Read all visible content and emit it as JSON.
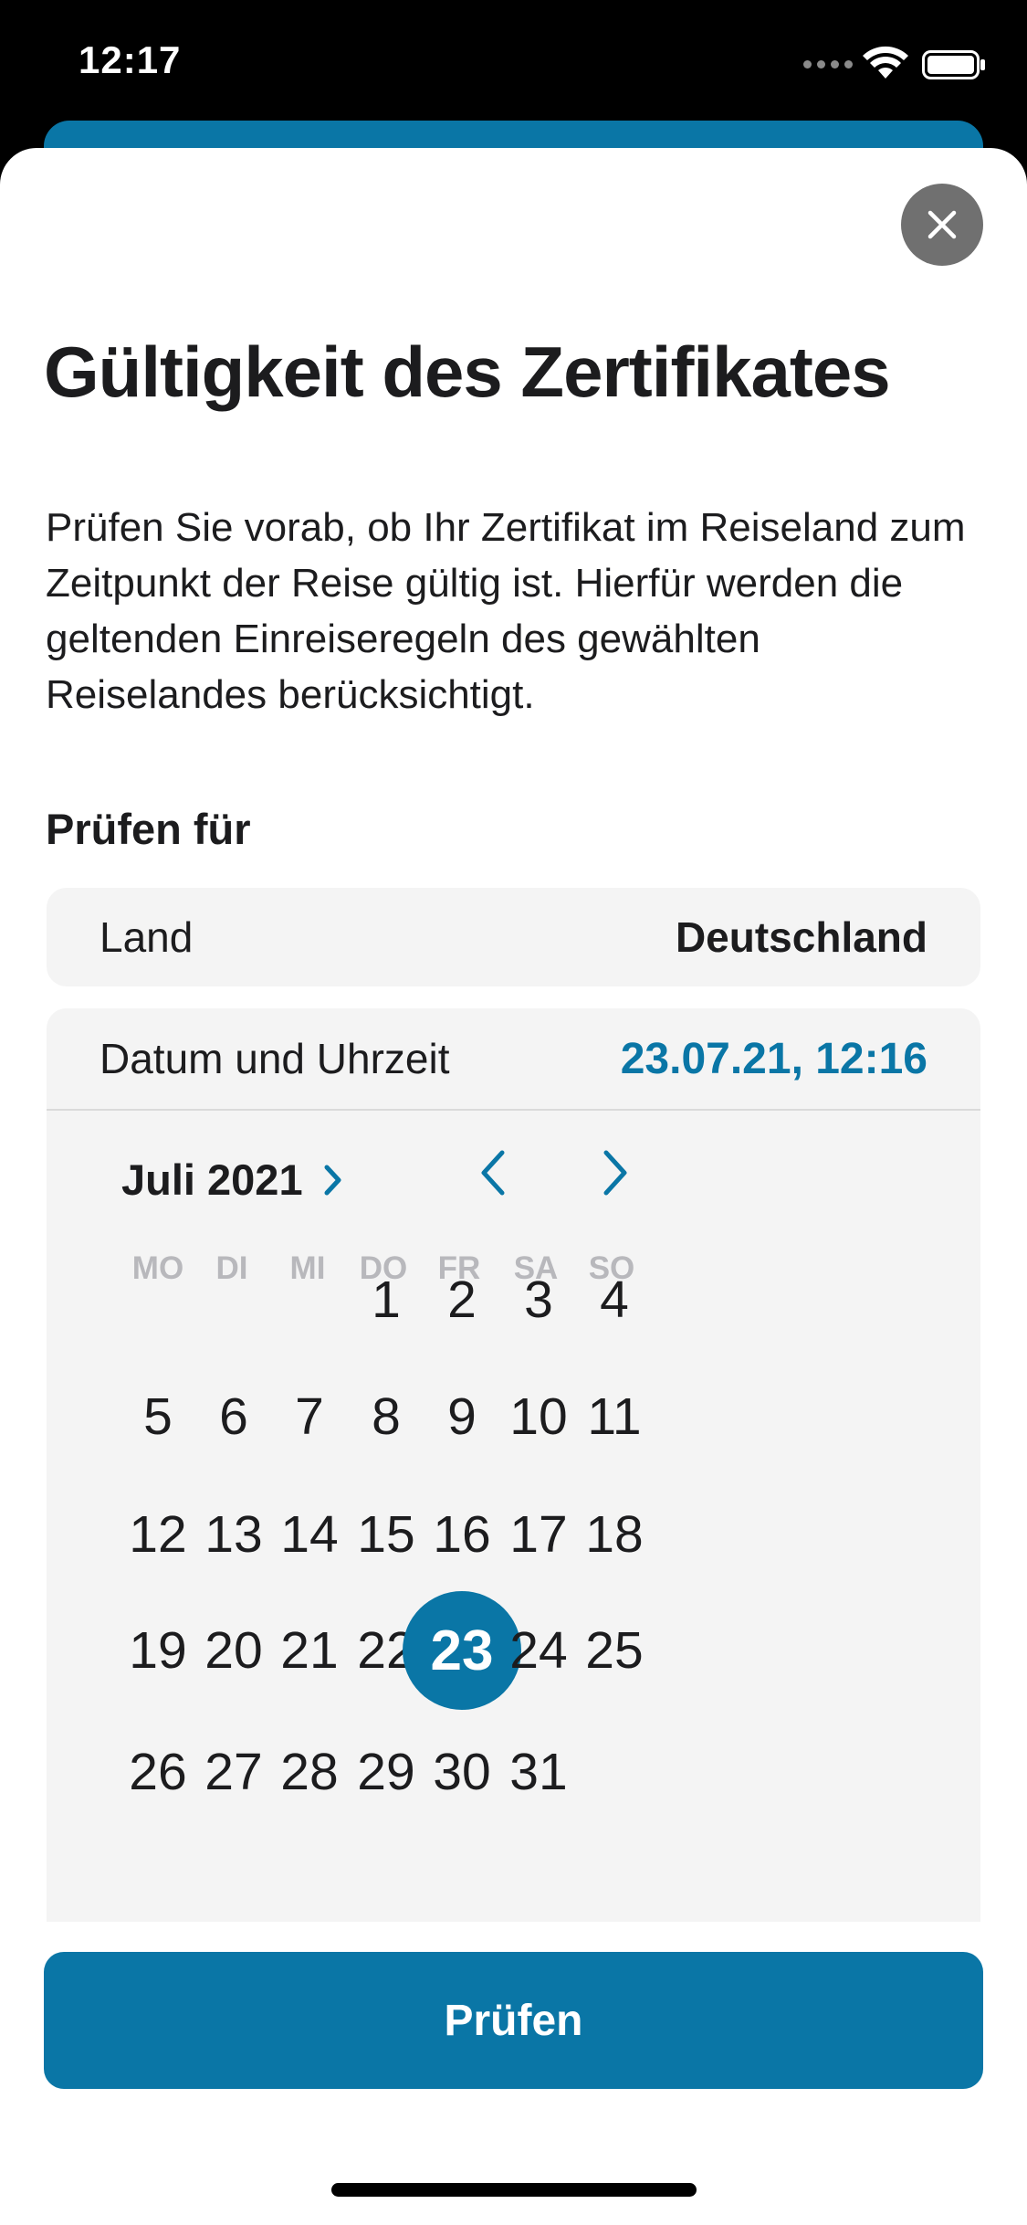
{
  "status_bar": {
    "time": "12:17",
    "icons": [
      "signal-icon",
      "wifi-icon",
      "battery-icon"
    ]
  },
  "sheet": {
    "title": "Gültigkeit des Zertifikates",
    "description": "Prüfen Sie vorab, ob Ihr Zertifikat im Reiseland zum Zeitpunkt der Reise gültig ist. Hierfür werden die geltenden Einreiseregeln des gewählten Reiselandes berücksichtigt.",
    "section_label": "Prüfen für",
    "country": {
      "label": "Land",
      "value": "Deutschland"
    },
    "date_time": {
      "label": "Datum und Uhrzeit",
      "value": "23.07.21, 12:16"
    },
    "calendar": {
      "month_label": "Juli 2021",
      "weekdays": [
        "MO",
        "DI",
        "MI",
        "DO",
        "FR",
        "SA",
        "SO"
      ],
      "first_weekday_index": 3,
      "days_in_month": 31,
      "selected_day": 23
    },
    "primary_button": "Prüfen"
  },
  "colors": {
    "accent": "#0a76a6",
    "panel_background": "#f4f4f4",
    "close_button": "#707070",
    "weekday_text": "#b8b8bc"
  }
}
